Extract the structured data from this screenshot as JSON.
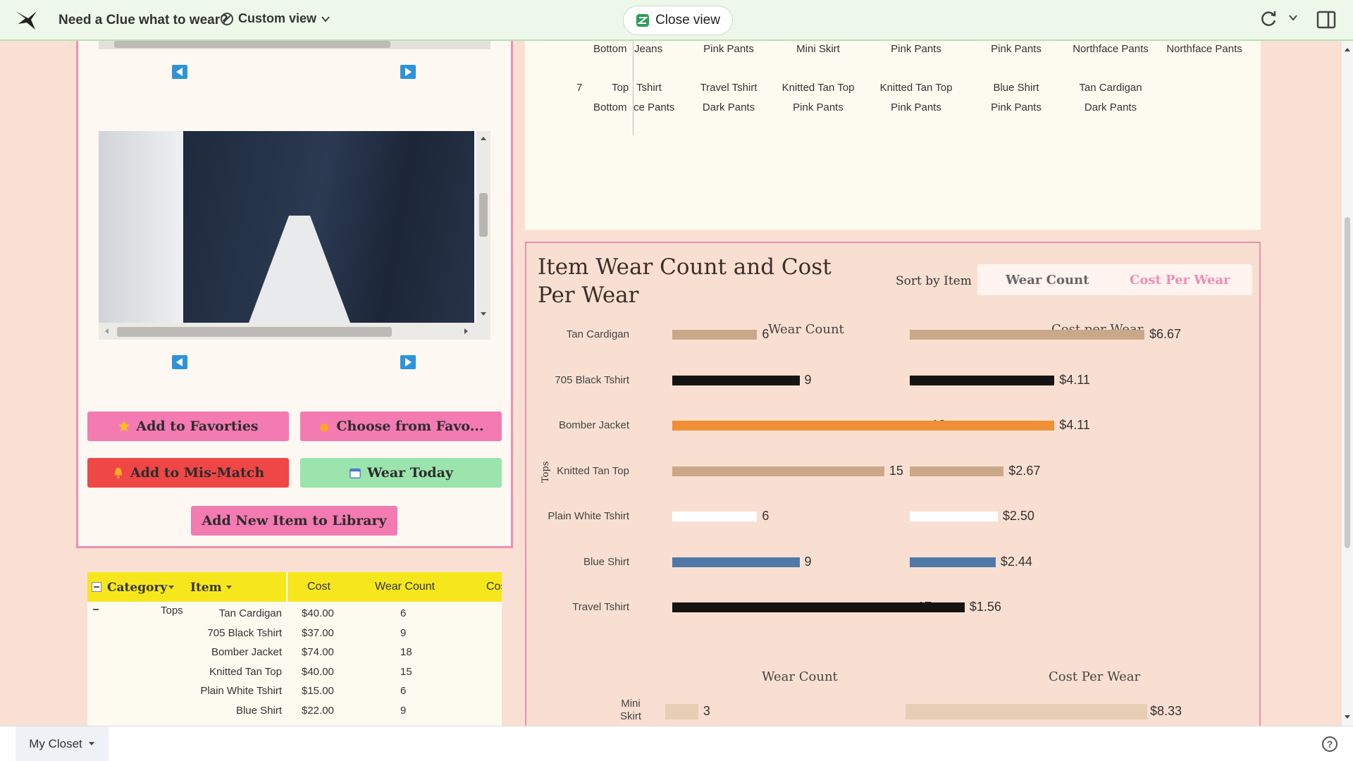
{
  "topbar": {
    "title": "Need a Clue what to wear?",
    "view_label": "Custom view",
    "close_view": "Close view"
  },
  "left_panel": {
    "buttons": {
      "add_favorites": "Add to Favorties",
      "choose_favorites": "Choose from Favo...",
      "add_mismatch": "Add to Mis-Match",
      "wear_today": "Wear Today",
      "add_item": "Add New Item to Library"
    },
    "table": {
      "headers": {
        "category": "Category",
        "item": "Item",
        "cost": "Cost",
        "wear_count": "Wear Count",
        "cost_per_wear": "Cos"
      },
      "group": "Tops",
      "rows": [
        {
          "item": "Tan Cardigan",
          "cost": "$40.00",
          "wear": "6"
        },
        {
          "item": "705 Black Tshirt",
          "cost": "$37.00",
          "wear": "9"
        },
        {
          "item": "Bomber Jacket",
          "cost": "$74.00",
          "wear": "18"
        },
        {
          "item": "Knitted Tan Top",
          "cost": "$40.00",
          "wear": "15"
        },
        {
          "item": "Plain White Tshirt",
          "cost": "$15.00",
          "wear": "6"
        },
        {
          "item": "Blue Shirt",
          "cost": "$22.00",
          "wear": "9"
        }
      ]
    }
  },
  "outfits": {
    "row6_label": "Bottom",
    "row6": [
      "Jeans",
      "Pink Pants",
      "Mini Skirt",
      "Pink Pants",
      "Pink Pants",
      "Northface Pants",
      "Northface Pants"
    ],
    "row7_number": "7",
    "row7_top_label": "Top",
    "row7_bottom_label": "Bottom",
    "row7_tops": [
      "Tshirt",
      "Travel Tshirt",
      "Knitted Tan Top",
      "Knitted Tan Top",
      "Blue Shirt",
      "Tan Cardigan"
    ],
    "row7_bottoms": [
      "ce Pants",
      "Dark Pants",
      "Pink Pants",
      "Pink Pants",
      "Pink Pants",
      "Dark Pants"
    ]
  },
  "chart_panel": {
    "title": "Item Wear Count and Cost Per Wear",
    "sort_label": "Sort by Item",
    "sort_options": [
      "Wear Count",
      "Cost Per Wear"
    ],
    "col_wear": "Wear Count",
    "col_cpw": "Cost per Wear",
    "col_wear_2": "Wear Count",
    "col_cpw_2": "Cost Per Wear",
    "category_tops": "Tops"
  },
  "chart_data": [
    {
      "type": "bar",
      "title": "Wear Count",
      "categories": [
        "Tan Cardigan",
        "705 Black Tshirt",
        "Bomber Jacket",
        "Knitted Tan Top",
        "Plain White Tshirt",
        "Blue Shirt",
        "Travel Tshirt"
      ],
      "values": [
        6,
        9,
        18,
        15,
        6,
        9,
        17
      ],
      "colors": [
        "#c9a889",
        "#161412",
        "#ef8f36",
        "#c9a889",
        "#ffffff",
        "#4f79a8",
        "#161412"
      ]
    },
    {
      "type": "bar",
      "title": "Cost per Wear",
      "categories": [
        "Tan Cardigan",
        "705 Black Tshirt",
        "Bomber Jacket",
        "Knitted Tan Top",
        "Plain White Tshirt",
        "Blue Shirt",
        "Travel Tshirt"
      ],
      "values": [
        6.67,
        4.11,
        4.11,
        2.67,
        2.5,
        2.44,
        1.56
      ],
      "labels": [
        "$6.67",
        "$4.11",
        "$4.11",
        "$2.67",
        "$2.50",
        "$2.44",
        "$1.56"
      ],
      "colors": [
        "#c9a889",
        "#161412",
        "#ef8f36",
        "#c9a889",
        "#ffffff",
        "#4f79a8",
        "#161412"
      ]
    },
    {
      "type": "bar",
      "title": "Wear Count",
      "categories": [
        "Mini Skirt"
      ],
      "values": [
        3
      ],
      "colors": [
        "#e6cdb4"
      ]
    },
    {
      "type": "bar",
      "title": "Cost Per Wear",
      "categories": [
        "Mini Skirt"
      ],
      "values": [
        8.33
      ],
      "labels": [
        "$8.33"
      ],
      "colors": [
        "#e6cdb4"
      ]
    }
  ],
  "bottombar": {
    "tab": "My Closet",
    "help": "?"
  }
}
